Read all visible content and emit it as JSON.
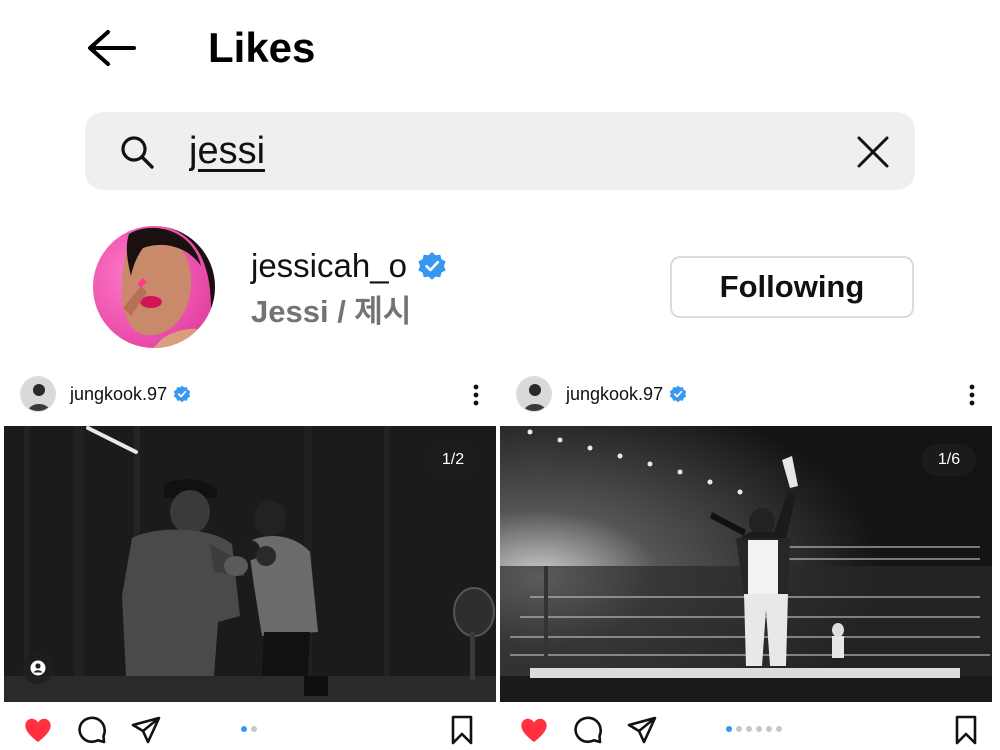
{
  "header": {
    "title": "Likes",
    "back_icon": "arrow-left-icon"
  },
  "search": {
    "value": "jessi",
    "search_icon": "search-icon",
    "clear_icon": "close-icon"
  },
  "result": {
    "username": "jessicah_o",
    "verified": true,
    "full_name": "Jessi / 제시",
    "follow_label": "Following"
  },
  "posts": [
    {
      "username": "jungkook.97",
      "verified": true,
      "counter": "1/2",
      "slide_count": 2,
      "active_slide": 1,
      "has_tag_button": true,
      "liked": true
    },
    {
      "username": "jungkook.97",
      "verified": true,
      "counter": "1/6",
      "slide_count": 6,
      "active_slide": 1,
      "has_tag_button": false,
      "liked": true
    }
  ],
  "colors": {
    "verified": "#3897f0",
    "like": "#ff3040",
    "dot_active": "#3897f0",
    "dot_inactive": "#c7c7c7"
  }
}
